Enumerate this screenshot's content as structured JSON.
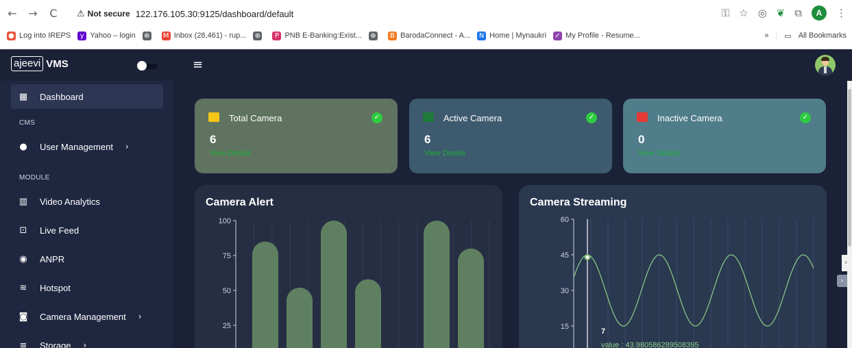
{
  "browser": {
    "back": "←",
    "forward": "→",
    "reload": "C",
    "warning_icon": "⚠",
    "not_secure": "Not secure",
    "url": "122.176.105.30:9125/dashboard/default",
    "profile_initial": "A",
    "bookmarks": [
      {
        "label": "Log into IREPS",
        "color": "#e8543a",
        "glyph": "●"
      },
      {
        "label": "Yahoo – login",
        "color": "#6001d2",
        "glyph": "y"
      },
      {
        "label": "",
        "color": "#5f6368",
        "glyph": "⊕"
      },
      {
        "label": "Inbox (28,461) - rup...",
        "color": "#ea4335",
        "glyph": "M"
      },
      {
        "label": "",
        "color": "#5f6368",
        "glyph": "⊕"
      },
      {
        "label": "PNB E-Banking:Exist...",
        "color": "#d6336c",
        "glyph": "P"
      },
      {
        "label": "",
        "color": "#5f6368",
        "glyph": "⊕"
      },
      {
        "label": "BarodaConnect - A...",
        "color": "#f47b20",
        "glyph": "B"
      },
      {
        "label": "Home | Mynaukri",
        "color": "#1a73e8",
        "glyph": "N"
      },
      {
        "label": "My Profile - Resume...",
        "color": "#8e44ad",
        "glyph": "✓"
      }
    ],
    "more_bookmarks": "»",
    "all_bookmarks": "All Bookmarks"
  },
  "app": {
    "brand_box": "ajeevi",
    "brand_text": "VMS",
    "menu_icon": "≡"
  },
  "sidebar": {
    "items": [
      {
        "label": "Dashboard",
        "icon": "▦",
        "arrow": ""
      },
      {
        "label": "User Management",
        "icon": "●",
        "arrow": "›"
      },
      {
        "label": "Video Analytics",
        "icon": "▥",
        "arrow": ""
      },
      {
        "label": "Live Feed",
        "icon": "⊡",
        "arrow": ""
      },
      {
        "label": "ANPR",
        "icon": "◉",
        "arrow": ""
      },
      {
        "label": "Hotspot",
        "icon": "≋",
        "arrow": ""
      },
      {
        "label": "Camera Management",
        "icon": "◙",
        "arrow": "›"
      },
      {
        "label": "Storage",
        "icon": "≡",
        "arrow": "›"
      }
    ],
    "sections": [
      "CMS",
      "MODULE"
    ]
  },
  "cards": [
    {
      "title": "Total Camera",
      "value": "6",
      "link": "View Details",
      "bg": "#5f7360",
      "icon_color": "#f5c518"
    },
    {
      "title": "Active Camera",
      "value": "6",
      "link": "View Details",
      "bg": "#3d5a6e",
      "icon_color": "#1f7a3a"
    },
    {
      "title": "Inactive Camera",
      "value": "0",
      "link": "View Details",
      "bg": "#507d8a",
      "icon_color": "#e53935"
    }
  ],
  "check_icon": "✓",
  "panels": {
    "alert_title": "Camera Alert",
    "streaming_title": "Camera Streaming",
    "tooltip_x": "7",
    "tooltip_value": "value : 43.980586289508395"
  },
  "chart_data": [
    {
      "type": "bar",
      "title": "Camera Alert",
      "values": [
        85,
        52,
        100,
        58,
        0,
        100,
        80
      ],
      "yticks": [
        "100",
        "75",
        "50",
        "25"
      ],
      "ylim": [
        0,
        100
      ],
      "color": "#5e8060"
    },
    {
      "type": "line",
      "title": "Camera Streaming",
      "yticks": [
        "60",
        "45",
        "30",
        "15"
      ],
      "ylim": [
        0,
        60
      ],
      "amplitude": 15,
      "center": 30,
      "cycles": 4,
      "color": "#8fd18a",
      "highlight": {
        "x": 7,
        "y": 43.980586289508395
      }
    }
  ]
}
